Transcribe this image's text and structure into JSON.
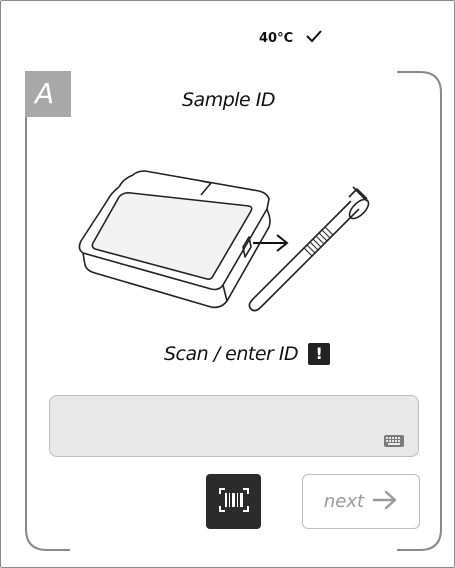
{
  "status": {
    "temperature": "40°C",
    "check_icon": "check-icon"
  },
  "step": {
    "letter": "A",
    "title": "Sample ID"
  },
  "prompt": {
    "text": "Scan / enter ID",
    "alert_symbol": "!"
  },
  "id_input": {
    "value": "",
    "icon": "keyboard-icon"
  },
  "buttons": {
    "scan_icon": "barcode-scan-icon",
    "next_label": "next",
    "next_icon": "arrow-right-icon"
  },
  "colors": {
    "badge_gray": "#a8a8a8",
    "dark": "#2b2b2b",
    "input_bg": "#e8e8e8",
    "disabled_text": "#9a9a9a"
  }
}
